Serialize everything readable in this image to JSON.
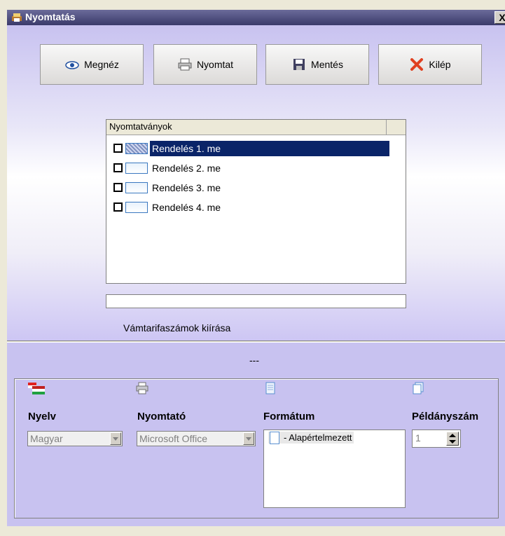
{
  "window": {
    "title": "Nyomtatás",
    "close_label": "X"
  },
  "toolbar": {
    "view_label": "Megnéz",
    "print_label": "Nyomtat",
    "save_label": "Mentés",
    "exit_label": "Kilép"
  },
  "forms_list": {
    "header": "Nyomtatványok",
    "items": [
      {
        "label": "Rendelés 1. me",
        "selected": true
      },
      {
        "label": "Rendelés 2. me",
        "selected": false
      },
      {
        "label": "Rendelés 3. me",
        "selected": false
      },
      {
        "label": "Rendelés 4. me",
        "selected": false
      }
    ]
  },
  "tariff_option_label": "Vámtarifaszámok kiírása",
  "bottom": {
    "status": "---",
    "language_label": "Nyelv",
    "language_value": "Magyar",
    "printer_label": "Nyomtató",
    "printer_value": "Microsoft Office",
    "format_label": "Formátum",
    "format_item": "- Alapértelmezett",
    "copies_label": "Példányszám",
    "copies_value": "1"
  },
  "colors": {
    "selection": "#0a2468",
    "panel": "#c8c2f0",
    "titlebar": "#3a3a6a"
  }
}
